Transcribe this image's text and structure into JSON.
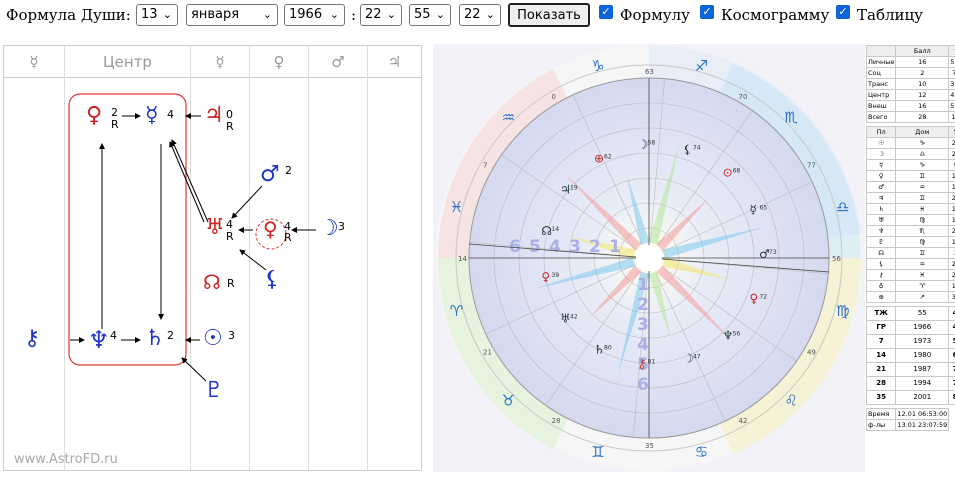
{
  "toolbar": {
    "label": "Формула Души:",
    "day": "13",
    "month": "января",
    "year": "1966",
    "colon": ":",
    "hour": "22",
    "minute": "55",
    "second": "22",
    "show_button": "Показать",
    "checkboxes": [
      {
        "label": "Формулу",
        "checked": true
      },
      {
        "label": "Космограмму",
        "checked": true
      },
      {
        "label": "Таблицу",
        "checked": true
      }
    ]
  },
  "formula": {
    "header": [
      "☿",
      "Центр",
      "☿",
      "♀",
      "♂",
      "♃"
    ],
    "watermark": "www.AstroFD.ru",
    "nodes": [
      {
        "glyph": "♀",
        "num": "2",
        "r": "R"
      },
      {
        "glyph": "☿",
        "num": "4",
        "r": ""
      },
      {
        "glyph": "♃",
        "num": "0",
        "r": "R"
      },
      {
        "glyph": "♂",
        "num": "2",
        "r": ""
      },
      {
        "glyph": "♅",
        "num": "4",
        "r": "R"
      },
      {
        "glyph": "♀",
        "num": "4",
        "r": "R"
      },
      {
        "glyph": "☽",
        "num": "3",
        "r": ""
      },
      {
        "glyph": "☊",
        "num": "",
        "r": "R"
      },
      {
        "glyph": "⚸",
        "num": "",
        "r": ""
      },
      {
        "glyph": "⚷",
        "num": "",
        "r": ""
      },
      {
        "glyph": "♆",
        "num": "4",
        "r": ""
      },
      {
        "glyph": "♄",
        "num": "2",
        "r": ""
      },
      {
        "glyph": "☉",
        "num": "3",
        "r": ""
      },
      {
        "glyph": "♇",
        "num": "",
        "r": ""
      }
    ]
  },
  "chart": {
    "degree_labels": [
      "63",
      "70",
      "77",
      "56",
      "49",
      "42",
      "35",
      "28",
      "21",
      "14",
      "7",
      "0"
    ],
    "center_numbers": [
      "1",
      "2",
      "3",
      "4",
      "5",
      "6"
    ],
    "planet_labels": [
      {
        "glyph": "⊕",
        "deg": "62"
      },
      {
        "glyph": "☽",
        "deg": "58"
      },
      {
        "glyph": "⚸",
        "deg": "74"
      },
      {
        "glyph": "⊙",
        "deg": "68"
      },
      {
        "glyph": "☿",
        "deg": "65"
      },
      {
        "glyph": "♂",
        "deg": "73"
      },
      {
        "glyph": "♀",
        "deg": "72"
      },
      {
        "glyph": "♆",
        "deg": "56"
      },
      {
        "glyph": "☽",
        "deg": "47"
      },
      {
        "glyph": "⚷",
        "deg": "81"
      },
      {
        "glyph": "♄",
        "deg": "80"
      },
      {
        "glyph": "♅",
        "deg": "42"
      },
      {
        "glyph": "♀",
        "deg": "39"
      },
      {
        "glyph": "☊",
        "deg": "14"
      },
      {
        "glyph": "♃",
        "deg": "19"
      }
    ]
  },
  "table": {
    "header": [
      "",
      "Балл",
      "%"
    ],
    "rows": [
      [
        "Личные",
        "16",
        "57,1"
      ],
      [
        "Соц",
        "2",
        "7,1"
      ],
      [
        "Транс",
        "10",
        "35,7"
      ],
      [
        "Центр",
        "12",
        "42,9"
      ],
      [
        "Внеш",
        "16",
        "57,1"
      ],
      [
        "Всего",
        "28",
        "100"
      ]
    ],
    "planet_header": [
      "Пл",
      "Дом",
      "Уг",
      "С",
      "Ор"
    ],
    "planet_rows": [
      [
        "☉",
        "♑",
        "23°",
        "3",
        "1"
      ],
      [
        "☽",
        "♎",
        "23°",
        "3",
        "3"
      ],
      [
        "☿",
        "♑",
        "9°",
        "4",
        "0"
      ],
      [
        "♀",
        "♊",
        "12°",
        "4R",
        "2"
      ],
      [
        "♂",
        "♒",
        "17°",
        "2",
        "2"
      ],
      [
        "♃",
        "♊",
        "23°",
        "0R",
        "1"
      ],
      [
        "♄",
        "♓",
        "14°",
        "2",
        "0"
      ],
      [
        "♅",
        "♍",
        "19°",
        "4R",
        "1"
      ],
      [
        "♆",
        "♏",
        "22°",
        "4",
        "0"
      ],
      [
        "♇",
        "♍",
        "18°",
        "2R",
        "0"
      ],
      [
        "☊",
        "♊",
        "3°",
        "0R",
        "1"
      ],
      [
        "⚸",
        "♒",
        "21°",
        "0",
        "2"
      ],
      [
        "⚷",
        "♓",
        "25°",
        "0",
        "1"
      ],
      [
        "♁",
        "♈",
        "19°",
        "0",
        "1"
      ],
      [
        "⊕",
        "↗",
        "30°",
        "0",
        "0"
      ]
    ],
    "years": [
      [
        "ТЖ",
        "55",
        "42",
        "2008"
      ],
      [
        "ГР",
        "1966",
        "49",
        "2015"
      ],
      [
        "7",
        "1973",
        "56",
        "2022"
      ],
      [
        "14",
        "1980",
        "63",
        "2029"
      ],
      [
        "21",
        "1987",
        "70",
        "2036"
      ],
      [
        "28",
        "1994",
        "77",
        "2043"
      ],
      [
        "35",
        "2001",
        "84",
        "2050"
      ]
    ],
    "time_rows": [
      [
        "Время",
        "12.01 06:53:00"
      ],
      [
        "ф-лы",
        "13.01 23:07:59"
      ]
    ]
  },
  "colors": {
    "accent_red": "#d21f1f",
    "accent_blue": "#1e34c8"
  }
}
